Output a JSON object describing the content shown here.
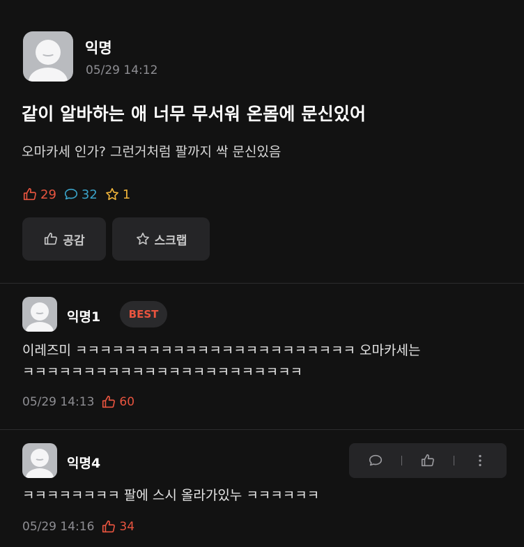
{
  "post": {
    "author": "익명",
    "time": "05/29 14:12",
    "title": "같이 알바하는 애 너무 무서워 온몸에 문신있어",
    "body": "오마카세 인가? 그런거처럼 팔까지 싹 문신있음",
    "stats": {
      "likes": "29",
      "comments": "32",
      "scraps": "1"
    },
    "buttons": {
      "like_label": "공감",
      "scrap_label": "스크랩"
    }
  },
  "comments": [
    {
      "author": "익명1",
      "badge": "BEST",
      "text": "이레즈미 ㅋㅋㅋㅋㅋㅋㅋㅋㅋㅋㅋㅋㅋㅋㅋㅋㅋㅋㅋㅋㅋㅋㅋ 오마카세는\nㅋㅋㅋㅋㅋㅋㅋㅋㅋㅋㅋㅋㅋㅋㅋㅋㅋㅋㅋㅋㅋㅋㅋ",
      "time": "05/29 14:13",
      "likes": "60"
    },
    {
      "author": "익명4",
      "text": "ㅋㅋㅋㅋㅋㅋㅋㅋ 팔에 스시 올라가있누 ㅋㅋㅋㅋㅋㅋ",
      "time": "05/29 14:16",
      "likes": "34"
    }
  ],
  "colors": {
    "background": "#121212",
    "like": "#e8543f",
    "comment": "#3aa3c9",
    "scrap": "#f0b43a"
  },
  "icons": [
    "thumbs-up-icon",
    "speech-bubble-icon",
    "star-icon",
    "more-vertical-icon"
  ]
}
